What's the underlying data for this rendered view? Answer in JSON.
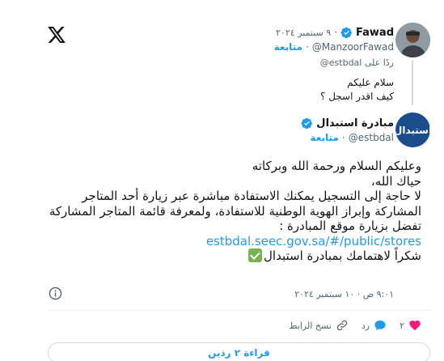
{
  "parent_tweet": {
    "name": "Fawad",
    "date": "٩ سبتمبر ٢٠٢٤",
    "handle": "@ManzoorFawad",
    "follow_label": "متابعة",
    "reply_prefix": "ردًا على",
    "reply_mention": "@estbdal",
    "text_lines": [
      "سلام عليكم",
      "كيف اقدر اسجل ؟"
    ]
  },
  "main_tweet": {
    "name": "مبادرة استبدال",
    "avatar_text": "استبدال",
    "handle": "@estbdal",
    "follow_label": "متابعة",
    "body_lines": [
      "وعليكم السلام ورحمة الله وبركاته",
      "حياك الله،",
      "لا حاجة إلى التسجيل يمكنك الاستفادة مباشرة عبر زيارة أحد المتاجر",
      "المشاركة وإبراز الهوية الوطنية للاستفادة، ولمعرفة قائمة المتاجر المشاركة",
      "تفضل بزيارة موقع المبادرة :"
    ],
    "link": "estbdal.seec.gov.sa/#/public/stores",
    "closing": "شكراً لاهتمامك بمبادرة استبدال",
    "timestamp": "٩:٠١ ص · ١٠ سبتمبر ٢٠٢٤"
  },
  "actions": {
    "like_count": "٢",
    "reply_label": "رد",
    "copy_link_label": "نسخ الرابط"
  },
  "read_replies_label": "قراءة ٢ رذين",
  "colors": {
    "accent": "#1d9bf0",
    "like": "#f91880",
    "secondary_text": "#536471",
    "verified": "#1d9bf0",
    "check_emoji": "#77b255"
  },
  "icons": [
    "x-logo-icon",
    "verified-badge-icon",
    "info-icon",
    "heart-icon",
    "reply-bubble-icon",
    "link-icon",
    "check-mark-emoji-icon"
  ]
}
